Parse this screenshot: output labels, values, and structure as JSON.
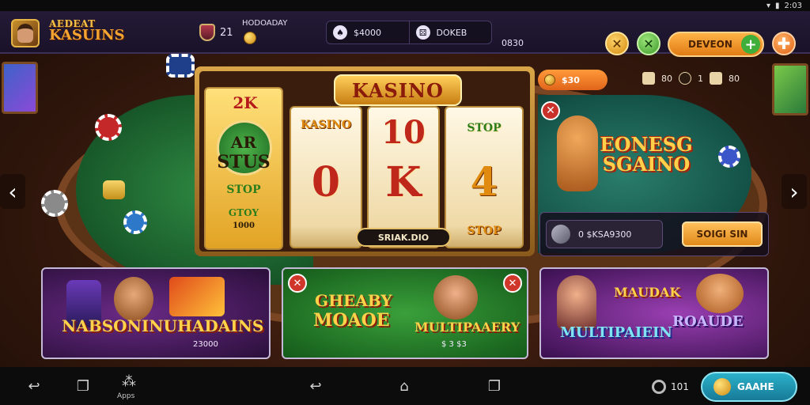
{
  "status_bar": {
    "time": "2:03"
  },
  "header": {
    "brand_line1": "AEDEAT",
    "brand_line2": "KASUINS",
    "level": "21",
    "daily_label": "HODOADAY",
    "pills": [
      {
        "icon": "spade-icon",
        "label": "$4000"
      },
      {
        "icon": "dice-icon",
        "label": "DOKEB"
      }
    ],
    "gems_value": "0830",
    "deposit_label": "DEVEON",
    "deposit_plus": "+",
    "tools_glyph": "✕",
    "close_glyph": "✕",
    "menu_glyph": "✚"
  },
  "slot": {
    "title": "KASINO",
    "reel1": {
      "badge": "2K",
      "line1": "AR",
      "line2": "STUS",
      "line3": "STOP",
      "line4": "GTOY",
      "line5": "1000"
    },
    "reel2": {
      "top": "KASINO",
      "mid": "0"
    },
    "reel3": {
      "top": "10",
      "mid": "K"
    },
    "reel4": {
      "top": "STOP",
      "mid": "4",
      "bot": "STOP"
    },
    "spin_label": "SRIAK.DIO"
  },
  "promo": {
    "coins": "$30",
    "stats": [
      "80",
      "1",
      "80"
    ],
    "close_glyph": "✕",
    "title": "EONESG SGAINO",
    "input_value": "0 $KSA9300",
    "signin_label": "SOIGI SIN"
  },
  "cards": [
    {
      "title_top": "NABSONINU",
      "title_main": "HADAINS",
      "sub": "23000"
    },
    {
      "title_top": "GHEABY",
      "title_main": "MOAOE",
      "title_right": "MULTIPAAERY",
      "sub": "$ 3 $3",
      "close_glyph": "✕"
    },
    {
      "title_top": "MAUDAK",
      "title_main": "MULTIPAIEIN",
      "title_right": "ROAUDE"
    }
  ],
  "bottom_nav": {
    "apps_label": "Apps",
    "balance": "101",
    "game_button": "GAAHE"
  },
  "colors": {
    "accent_orange": "#e08a1a",
    "accent_teal": "#177a98",
    "felt_green": "#18592a"
  }
}
